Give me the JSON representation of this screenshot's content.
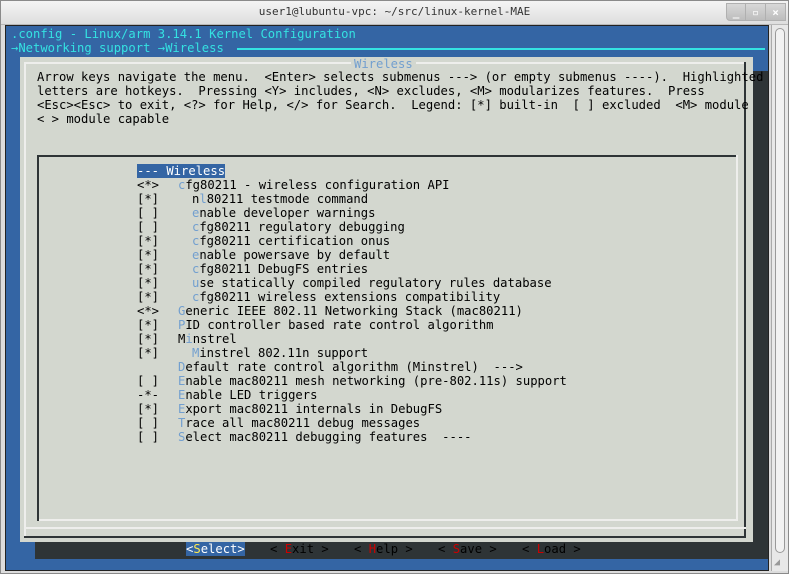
{
  "window": {
    "title": "user1@lubuntu-vpc: ~/src/linux-kernel-MAE",
    "buttons": [
      {
        "name": "minimize",
        "glyph": "_"
      },
      {
        "name": "maximize",
        "glyph": "▫"
      },
      {
        "name": "close",
        "glyph": "×"
      }
    ]
  },
  "header": {
    "title": ".config - Linux/arm 3.14.1 Kernel Configuration",
    "breadcrumb": "→Networking support →Wireless"
  },
  "dialog": {
    "title": "Wireless",
    "help_lines": [
      "Arrow keys navigate the menu.  <Enter> selects submenus ---> (or empty submenus ----).  Highlighted",
      "letters are hotkeys.  Pressing <Y> includes, <N> excludes, <M> modularizes features.  Press",
      "<Esc><Esc> to exit, <?> for Help, </> for Search.  Legend: [*] built-in  [ ] excluded  <M> module",
      "< > module capable"
    ],
    "items": [
      {
        "state": "",
        "indent": 0,
        "pre": "",
        "hotkey": "",
        "rest": "--- Wireless",
        "selected": true
      },
      {
        "state": "<*>",
        "indent": 0,
        "pre": "",
        "hotkey": "c",
        "rest": "fg80211 - wireless configuration API",
        "selected": false
      },
      {
        "state": "[*]",
        "indent": 2,
        "pre": "n",
        "hotkey": "l",
        "rest": "80211 testmode command",
        "selected": false
      },
      {
        "state": "[ ]",
        "indent": 2,
        "pre": "",
        "hotkey": "e",
        "rest": "nable developer warnings",
        "selected": false
      },
      {
        "state": "[ ]",
        "indent": 2,
        "pre": "",
        "hotkey": "c",
        "rest": "fg80211 regulatory debugging",
        "selected": false
      },
      {
        "state": "[*]",
        "indent": 2,
        "pre": "",
        "hotkey": "c",
        "rest": "fg80211 certification onus",
        "selected": false
      },
      {
        "state": "[*]",
        "indent": 2,
        "pre": "",
        "hotkey": "e",
        "rest": "nable powersave by default",
        "selected": false
      },
      {
        "state": "[*]",
        "indent": 2,
        "pre": "",
        "hotkey": "c",
        "rest": "fg80211 DebugFS entries",
        "selected": false
      },
      {
        "state": "[*]",
        "indent": 2,
        "pre": "",
        "hotkey": "u",
        "rest": "se statically compiled regulatory rules database",
        "selected": false
      },
      {
        "state": "[*]",
        "indent": 2,
        "pre": "",
        "hotkey": "c",
        "rest": "fg80211 wireless extensions compatibility",
        "selected": false
      },
      {
        "state": "<*>",
        "indent": 0,
        "pre": "",
        "hotkey": "G",
        "rest": "eneric IEEE 802.11 Networking Stack (mac80211)",
        "selected": false
      },
      {
        "state": "[*]",
        "indent": 0,
        "pre": "",
        "hotkey": "P",
        "rest": "ID controller based rate control algorithm",
        "selected": false
      },
      {
        "state": "[*]",
        "indent": 0,
        "pre": "M",
        "hotkey": "i",
        "rest": "nstrel",
        "selected": false
      },
      {
        "state": "[*]",
        "indent": 2,
        "pre": "",
        "hotkey": "M",
        "rest": "instrel 802.11n support",
        "selected": false
      },
      {
        "state": "",
        "indent": 0,
        "pre": "",
        "hotkey": "D",
        "rest": "efault rate control algorithm (Minstrel)  --->",
        "selected": false
      },
      {
        "state": "[ ]",
        "indent": 0,
        "pre": "",
        "hotkey": "E",
        "rest": "nable mac80211 mesh networking (pre-802.11s) support",
        "selected": false
      },
      {
        "state": "-*-",
        "indent": 0,
        "pre": "",
        "hotkey": "E",
        "rest": "nable LED triggers",
        "selected": false
      },
      {
        "state": "[*]",
        "indent": 0,
        "pre": "",
        "hotkey": "E",
        "rest": "xport mac80211 internals in DebugFS",
        "selected": false
      },
      {
        "state": "[ ]",
        "indent": 0,
        "pre": "",
        "hotkey": "T",
        "rest": "race all mac80211 debug messages",
        "selected": false
      },
      {
        "state": "[ ]",
        "indent": 0,
        "pre": "",
        "hotkey": "S",
        "rest": "elect mac80211 debugging features  ----",
        "selected": false
      }
    ],
    "buttons": [
      {
        "id": "select",
        "left": "<",
        "hotkey": "S",
        "rest": "elect",
        "right": ">",
        "active": true
      },
      {
        "id": "exit",
        "left": "< ",
        "hotkey": "E",
        "rest": "xit",
        "right": " >",
        "active": false
      },
      {
        "id": "help",
        "left": "< ",
        "hotkey": "H",
        "rest": "elp",
        "right": " >",
        "active": false
      },
      {
        "id": "save",
        "left": "< ",
        "hotkey": "S",
        "rest": "ave",
        "right": " >",
        "active": false
      },
      {
        "id": "load",
        "left": "< ",
        "hotkey": "L",
        "rest": "oad",
        "right": " >",
        "active": false
      }
    ]
  },
  "colors": {
    "background": "#3465a4",
    "dialog": "#d3d7cf",
    "accent_cyan": "#34e2e2",
    "hotkey": "#729fcf",
    "button_hotkey": "#cc0000",
    "active_hotkey": "#fce94f",
    "shadow": "#2e3436"
  }
}
